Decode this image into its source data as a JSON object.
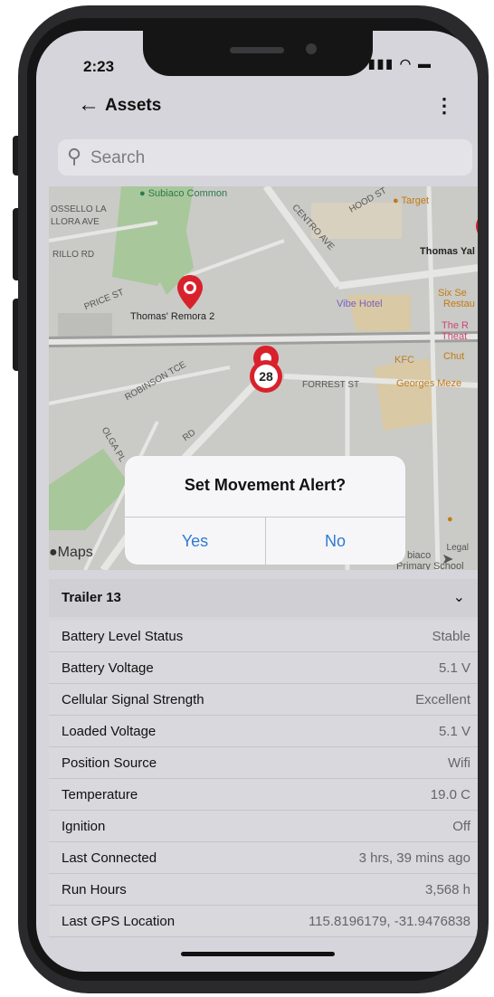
{
  "status": {
    "time": "2:23",
    "icons": "signal wifi battery"
  },
  "header": {
    "title": "Assets",
    "back_icon": "arrow-left-icon",
    "menu_icon": "kebab-icon"
  },
  "search": {
    "placeholder": "Search"
  },
  "map": {
    "streets": [
      "OSSELLO LA",
      "LLORA AVE",
      "RILLO RD",
      "PRICE ST",
      "HOOD ST",
      "CENTRO AVE",
      "ROBINSON TCE",
      "OLGA PL",
      "RD",
      "FORREST ST"
    ],
    "pois": [
      "Subiaco Common",
      "Target",
      "Thomas Yal",
      "Six Se",
      "Restau",
      "Vibe Hotel",
      "The R",
      "Theat",
      "KFC",
      "Chut",
      "Georges Meze",
      "biaco",
      "Primary School"
    ],
    "assets": [
      {
        "label": "Thomas' Remora 2"
      }
    ],
    "cluster_count": "28",
    "attribution": "Maps",
    "legal": "Legal"
  },
  "dialog": {
    "title": "Set Movement Alert?",
    "yes": "Yes",
    "no": "No"
  },
  "asset": {
    "name": "Trailer 13",
    "rows": [
      {
        "label": "Battery Level Status",
        "value": "Stable"
      },
      {
        "label": "Battery Voltage",
        "value": "5.1 V"
      },
      {
        "label": "Cellular Signal Strength",
        "value": "Excellent"
      },
      {
        "label": "Loaded Voltage",
        "value": "5.1 V"
      },
      {
        "label": "Position Source",
        "value": "Wifi"
      },
      {
        "label": "Temperature",
        "value": "19.0 C"
      },
      {
        "label": "Ignition",
        "value": "Off"
      },
      {
        "label": "Last Connected",
        "value": "3 hrs, 39 mins ago"
      },
      {
        "label": "Run Hours",
        "value": "3,568 h"
      },
      {
        "label": "Last GPS Location",
        "value": "115.8196179, -31.9476838"
      }
    ]
  },
  "colors": {
    "pin": "#d9212c",
    "link": "#2f7ad3",
    "park": "#9cc38e",
    "road": "#e9e9e6"
  }
}
